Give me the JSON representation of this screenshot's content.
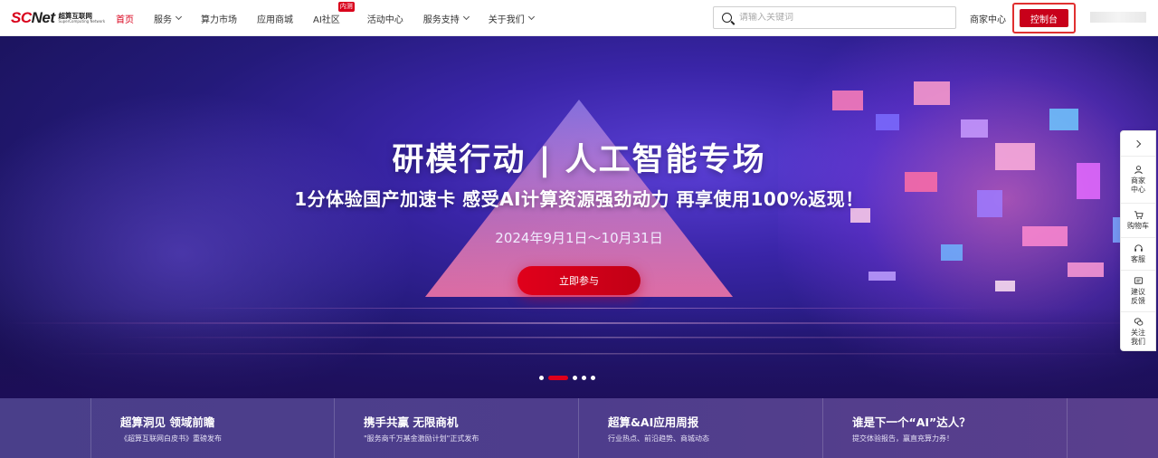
{
  "header": {
    "logo": {
      "mark_sc": "SC",
      "mark_net": "Net",
      "cn": "超算互联网",
      "en": "SuperComputing Network"
    },
    "nav": [
      {
        "label": "首页",
        "active": true,
        "dropdown": false
      },
      {
        "label": "服务",
        "dropdown": true
      },
      {
        "label": "算力市场",
        "dropdown": false
      },
      {
        "label": "应用商城",
        "dropdown": false
      },
      {
        "label": "AI社区",
        "dropdown": false,
        "badge": "内测"
      },
      {
        "label": "活动中心",
        "dropdown": false
      },
      {
        "label": "服务支持",
        "dropdown": true
      },
      {
        "label": "关于我们",
        "dropdown": true
      }
    ],
    "search": {
      "placeholder": "请输入关键词",
      "value": ""
    },
    "merchant_center": "商家中心",
    "console_button": "控制台"
  },
  "banner": {
    "title": "研模行动 | 人工智能专场",
    "subtitle": "1分体验国产加速卡 感受AI计算资源强劲动力 再享使用100%返现！",
    "date": "2024年9月1日～10月31日",
    "cta": "立即参与",
    "slides": {
      "total": 5,
      "active_index": 1
    }
  },
  "strip": [
    {
      "title": "超算洞见 领域前瞻",
      "desc": "《超算互联网白皮书》重磅发布"
    },
    {
      "title": "携手共赢 无限商机",
      "desc": "\"服务商千万基金激励计划\"正式发布"
    },
    {
      "title": "超算&AI应用周报",
      "desc": "行业热点、前沿趋势、商城动态"
    },
    {
      "title": "谁是下一个“AI”达人？",
      "desc": "提交体验报告，赢直充算力券！"
    }
  ],
  "float_panel": [
    {
      "icon": "user-icon",
      "label": "商家中心"
    },
    {
      "icon": "cart-icon",
      "label": "购物车"
    },
    {
      "icon": "headset-icon",
      "label": "客服"
    },
    {
      "icon": "feedback-icon",
      "label": "建议反馈"
    },
    {
      "icon": "wechat-icon",
      "label": "关注我们"
    }
  ],
  "colors": {
    "brand_red": "#d9001b",
    "console_red": "#c8001a",
    "banner_purple": "#3a25a8",
    "strip_purple": "#4e3d8c"
  }
}
